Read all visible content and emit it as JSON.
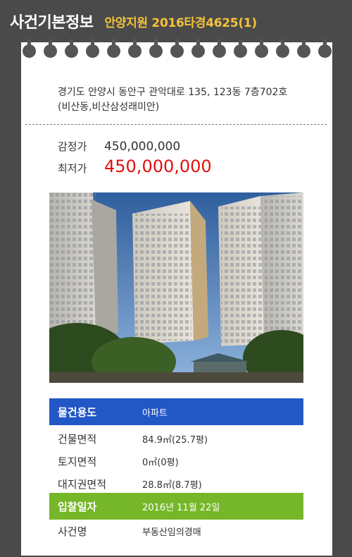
{
  "header": {
    "title": "사건기본정보",
    "case_info": "안양지원 2016타경4625(1)"
  },
  "address": "경기도 안양시 동안구 관악대로 135, 123동 7층702호 (비산동,비산삼성래미안)",
  "prices": {
    "appraisal_label": "감정가",
    "appraisal_value": "450,000,000",
    "minimum_label": "최저가",
    "minimum_value": "450,000,000"
  },
  "colors": {
    "header_bg": "#4a4a4a",
    "case_text": "#f5c23a",
    "min_price": "#e01010",
    "usage_row": "#2257c6",
    "date_row": "#76b72a"
  },
  "details": [
    {
      "label": "물건용도",
      "value": "아파트"
    },
    {
      "label": "건물면적",
      "value": "84.9㎡(25.7평)"
    },
    {
      "label": "토지면적",
      "value": "0㎡(0평)"
    },
    {
      "label": "대지권면적",
      "value": "28.8㎡(8.7평)"
    },
    {
      "label": "입찰일자",
      "value": "2016년 11월 22일"
    },
    {
      "label": "사건명",
      "value": "부동산임의경매"
    }
  ]
}
